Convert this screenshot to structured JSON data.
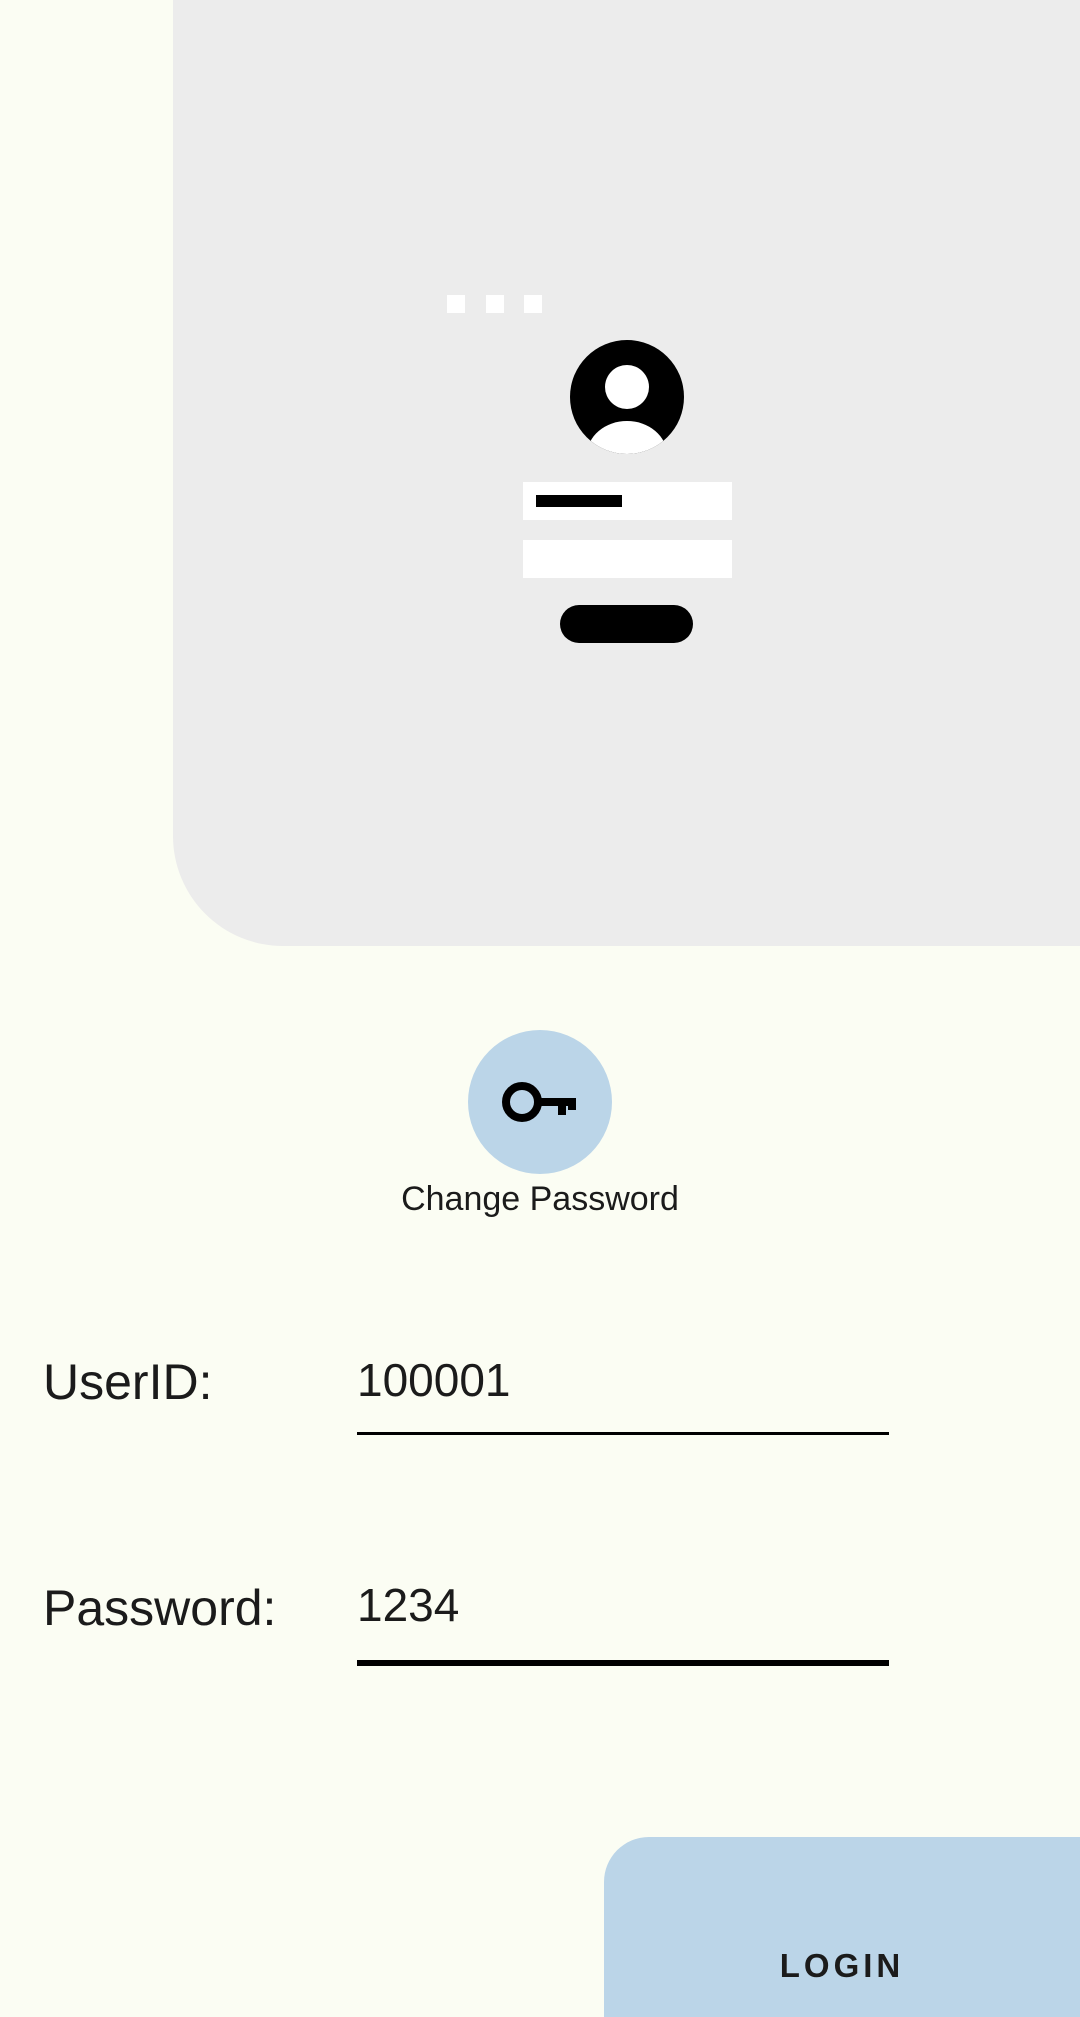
{
  "hero": {
    "illustration_icon": "login-illustration",
    "avatar_icon": "account-circle-icon"
  },
  "change_password": {
    "icon": "key-icon",
    "label": "Change Password"
  },
  "form": {
    "userid_label": "UserID:",
    "userid_value": "100001",
    "password_label": "Password:",
    "password_value": "1234"
  },
  "login": {
    "label": "LOGIN"
  },
  "colors": {
    "background": "#FBFDF3",
    "card": "#ECECEC",
    "accent": "#BBD5E8",
    "text": "#1b1b1b"
  }
}
